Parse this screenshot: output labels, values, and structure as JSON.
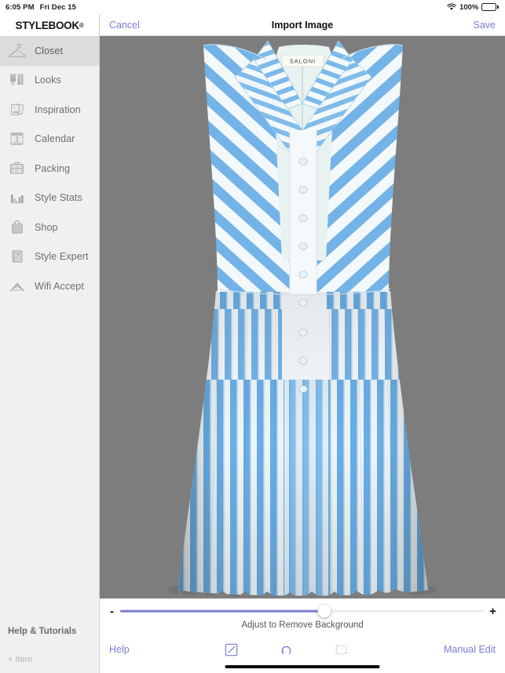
{
  "statusbar": {
    "time": "6:05 PM",
    "date": "Fri Dec 15",
    "battery_percent": "100%",
    "wifi_icon": "wifi-icon",
    "battery_icon": "battery-full-icon"
  },
  "sidebar": {
    "brand": "STYLEBOOK",
    "brand_dot": "®",
    "items": [
      {
        "label": "Closet",
        "icon": "hanger-icon",
        "selected": true
      },
      {
        "label": "Looks",
        "icon": "outfit-icon",
        "selected": false
      },
      {
        "label": "Inspiration",
        "icon": "photos-icon",
        "selected": false
      },
      {
        "label": "Calendar",
        "icon": "calendar-icon",
        "selected": false
      },
      {
        "label": "Packing",
        "icon": "suitcase-icon",
        "selected": false
      },
      {
        "label": "Style Stats",
        "icon": "bar-chart-icon",
        "selected": false
      },
      {
        "label": "Shop",
        "icon": "shopping-bag-icon",
        "selected": false
      },
      {
        "label": "Style Expert",
        "icon": "book-icon",
        "selected": false
      },
      {
        "label": "Wifi Accept",
        "icon": "envelope-icon",
        "selected": false
      }
    ],
    "help_tutorials": "Help & Tutorials",
    "add_item": "+ Item"
  },
  "topbar": {
    "cancel_label": "Cancel",
    "title": "Import Image",
    "save_label": "Save"
  },
  "canvas": {
    "background_color": "#7d7d7d",
    "garment_brand_label": "SALONI",
    "garment_description": "blue and white striped sleeveless midi shirt dress"
  },
  "bottom": {
    "slider": {
      "minus_label": "-",
      "plus_label": "+",
      "value_percent": 56,
      "fill_color": "#7b7dd2",
      "track_color": "#ebebeb"
    },
    "caption": "Adjust to Remove Background",
    "toolbar": {
      "help_label": "Help",
      "manual_edit_label": "Manual Edit",
      "icons": [
        {
          "name": "edit-square-icon"
        },
        {
          "name": "undo-rotate-icon"
        },
        {
          "name": "marquee-select-icon"
        }
      ]
    }
  },
  "colors": {
    "accent": "#7b7dd2",
    "sidebar_bg": "#f0f0f0",
    "selected_bg": "#dcdcdc",
    "canvas_gray": "#7d7d7d"
  }
}
